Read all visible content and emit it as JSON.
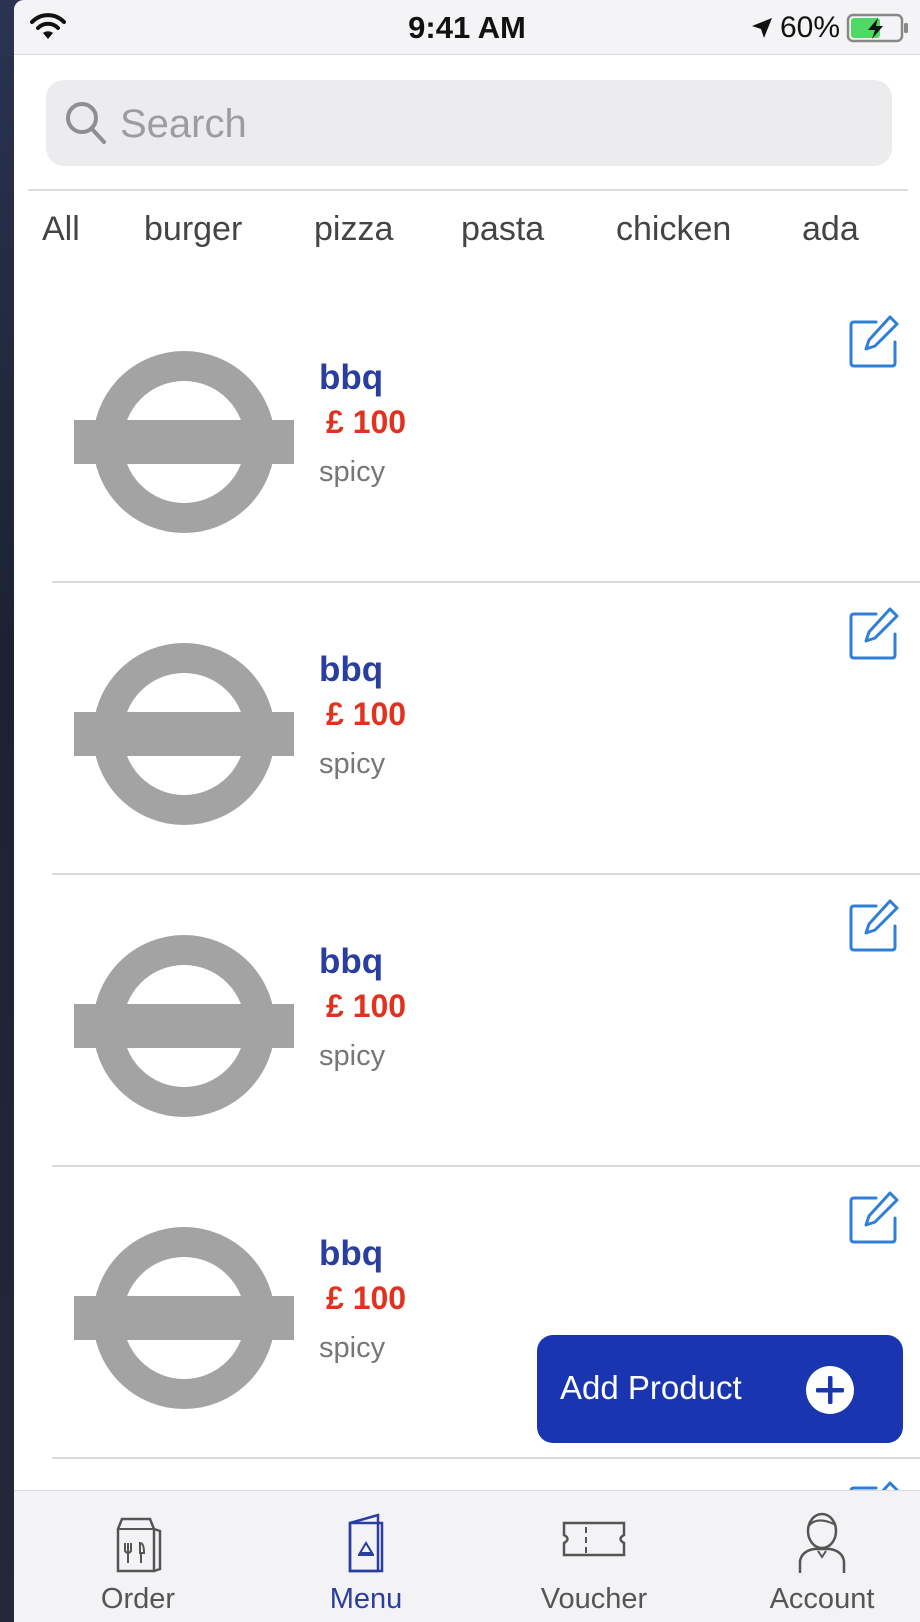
{
  "status_bar": {
    "time": "9:41 AM",
    "battery_percent": "60%",
    "battery_level": 0.6,
    "icons": [
      "wifi-icon",
      "location-arrow-icon",
      "battery-charging-icon"
    ]
  },
  "search": {
    "placeholder": "Search",
    "value": ""
  },
  "categories": [
    "All",
    "burger",
    "pizza",
    "pasta",
    "chicken",
    "ada"
  ],
  "products": [
    {
      "name": "bbq",
      "price": "£ 100",
      "description": "spicy",
      "image_icon": "placeholder-logo-icon",
      "edit_icon": "edit-icon"
    },
    {
      "name": "bbq",
      "price": "£ 100",
      "description": "spicy",
      "image_icon": "placeholder-logo-icon",
      "edit_icon": "edit-icon"
    },
    {
      "name": "bbq",
      "price": "£ 100",
      "description": "spicy",
      "image_icon": "placeholder-logo-icon",
      "edit_icon": "edit-icon"
    },
    {
      "name": "bbq",
      "price": "£ 100",
      "description": "spicy",
      "image_icon": "placeholder-logo-icon",
      "edit_icon": "edit-icon"
    }
  ],
  "add_product": {
    "label": "Add Product",
    "icon": "plus-circle-icon"
  },
  "tab_bar": {
    "active": "Menu",
    "tabs": [
      {
        "label": "Order",
        "icon": "shopping-bag-icon"
      },
      {
        "label": "Menu",
        "icon": "menu-booklet-icon"
      },
      {
        "label": "Voucher",
        "icon": "ticket-icon"
      },
      {
        "label": "Account",
        "icon": "user-icon"
      }
    ]
  },
  "colors": {
    "accent": "#1a35b0",
    "product_name": "#2a3ea0",
    "price": "#e0321e",
    "placeholder_gray": "#a3a3a3",
    "edit_icon": "#2f7fd8"
  }
}
